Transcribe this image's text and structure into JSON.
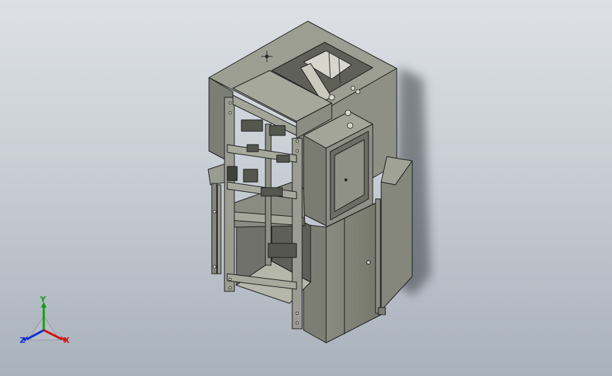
{
  "viewport": {
    "background_top": "#dde1e6",
    "background_bottom": "#a9b1bb"
  },
  "model": {
    "body_color": "#8d8f84",
    "dark_color": "#6e7068",
    "light_color": "#b9baae",
    "edge_color": "#1c1c1c"
  },
  "triad": {
    "x_label": "X",
    "y_label": "Y",
    "z_label": "Z",
    "x_color": "#d01010",
    "y_color": "#10a010",
    "z_color": "#1030d0"
  }
}
